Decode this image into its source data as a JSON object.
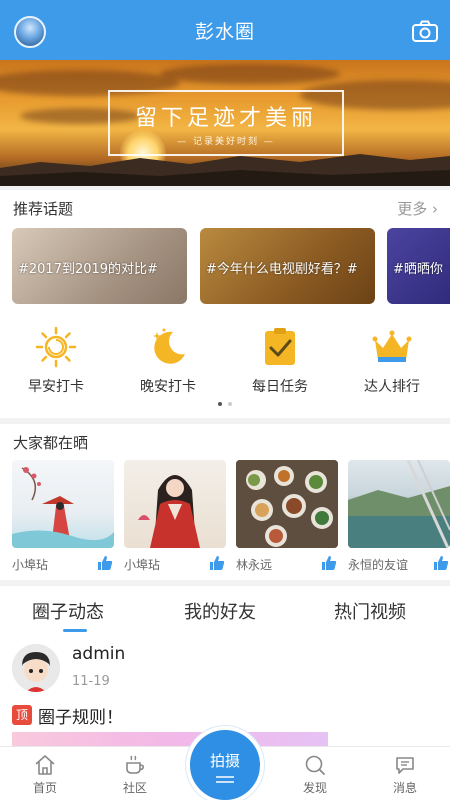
{
  "header": {
    "title": "彭水圈",
    "camera_icon": "camera-icon"
  },
  "banner": {
    "headline": "留下足迹才美丽",
    "subtitle": "— 记录美好时刻 —"
  },
  "topics": {
    "title": "推荐话题",
    "more": "更多",
    "items": [
      {
        "label": "#2017到2019的对比#"
      },
      {
        "label": "#今年什么电视剧好看？#"
      },
      {
        "label": "#晒晒你"
      }
    ]
  },
  "quick": [
    {
      "label": "早安打卡",
      "icon": "sun-icon"
    },
    {
      "label": "晚安打卡",
      "icon": "moon-icon"
    },
    {
      "label": "每日任务",
      "icon": "clipboard-check-icon"
    },
    {
      "label": "达人排行",
      "icon": "crown-icon"
    }
  ],
  "shares": {
    "title": "大家都在晒",
    "items": [
      {
        "user": "小埠玷"
      },
      {
        "user": "小埠玷"
      },
      {
        "user": "林永远"
      },
      {
        "user": "永恒的友谊"
      }
    ]
  },
  "tabs": [
    "圈子动态",
    "我的好友",
    "热门视频"
  ],
  "post": {
    "user": "admin",
    "date": "11-19",
    "pin": "顶",
    "title": "圈子规则！"
  },
  "nav": {
    "home": "首页",
    "community": "社区",
    "shoot": "拍摄",
    "discover": "发现",
    "messages": "消息"
  },
  "colors": {
    "brand": "#3d9bea",
    "pin": "#e84b3c"
  }
}
